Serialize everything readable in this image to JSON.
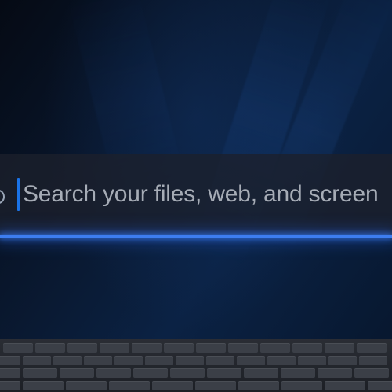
{
  "search": {
    "placeholder": "Search your files, web, and screen"
  },
  "colors": {
    "accent": "#1a73e8",
    "glow_line": "#3d7df0",
    "placeholder_text": "#a6acb6",
    "background": "#07111f"
  },
  "icons": {
    "search": "search-icon"
  }
}
